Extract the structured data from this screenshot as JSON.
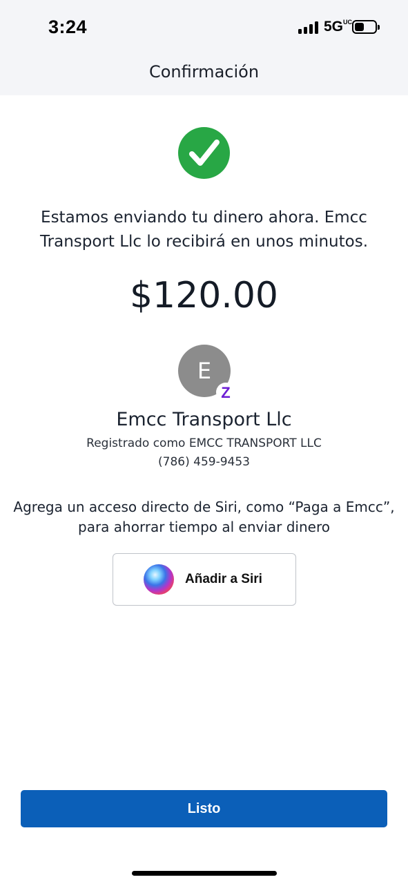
{
  "status_bar": {
    "time": "3:24",
    "network": "5G",
    "network_suffix": "UC"
  },
  "header": {
    "title": "Confirmación"
  },
  "confirmation": {
    "icon": "checkmark-circle-icon",
    "message": "Estamos enviando tu dinero ahora. Emcc Transport Llc lo recibirá en unos minutos.",
    "amount": "$120.00"
  },
  "payee": {
    "avatar_initial": "E",
    "badge": "Z",
    "name": "Emcc Transport Llc",
    "registered": "Registrado como EMCC TRANSPORT LLC",
    "phone": "(786) 459-9453"
  },
  "siri": {
    "prompt": "Agrega un acceso directo de Siri, como “Paga a Emcc”, para ahorrar tiempo al enviar dinero",
    "button_label": "Añadir a Siri"
  },
  "footer": {
    "done_label": "Listo"
  },
  "colors": {
    "success": "#28a745",
    "primary": "#0b5fb8",
    "zelle": "#6d1ed4",
    "avatar": "#8c8c8c"
  }
}
